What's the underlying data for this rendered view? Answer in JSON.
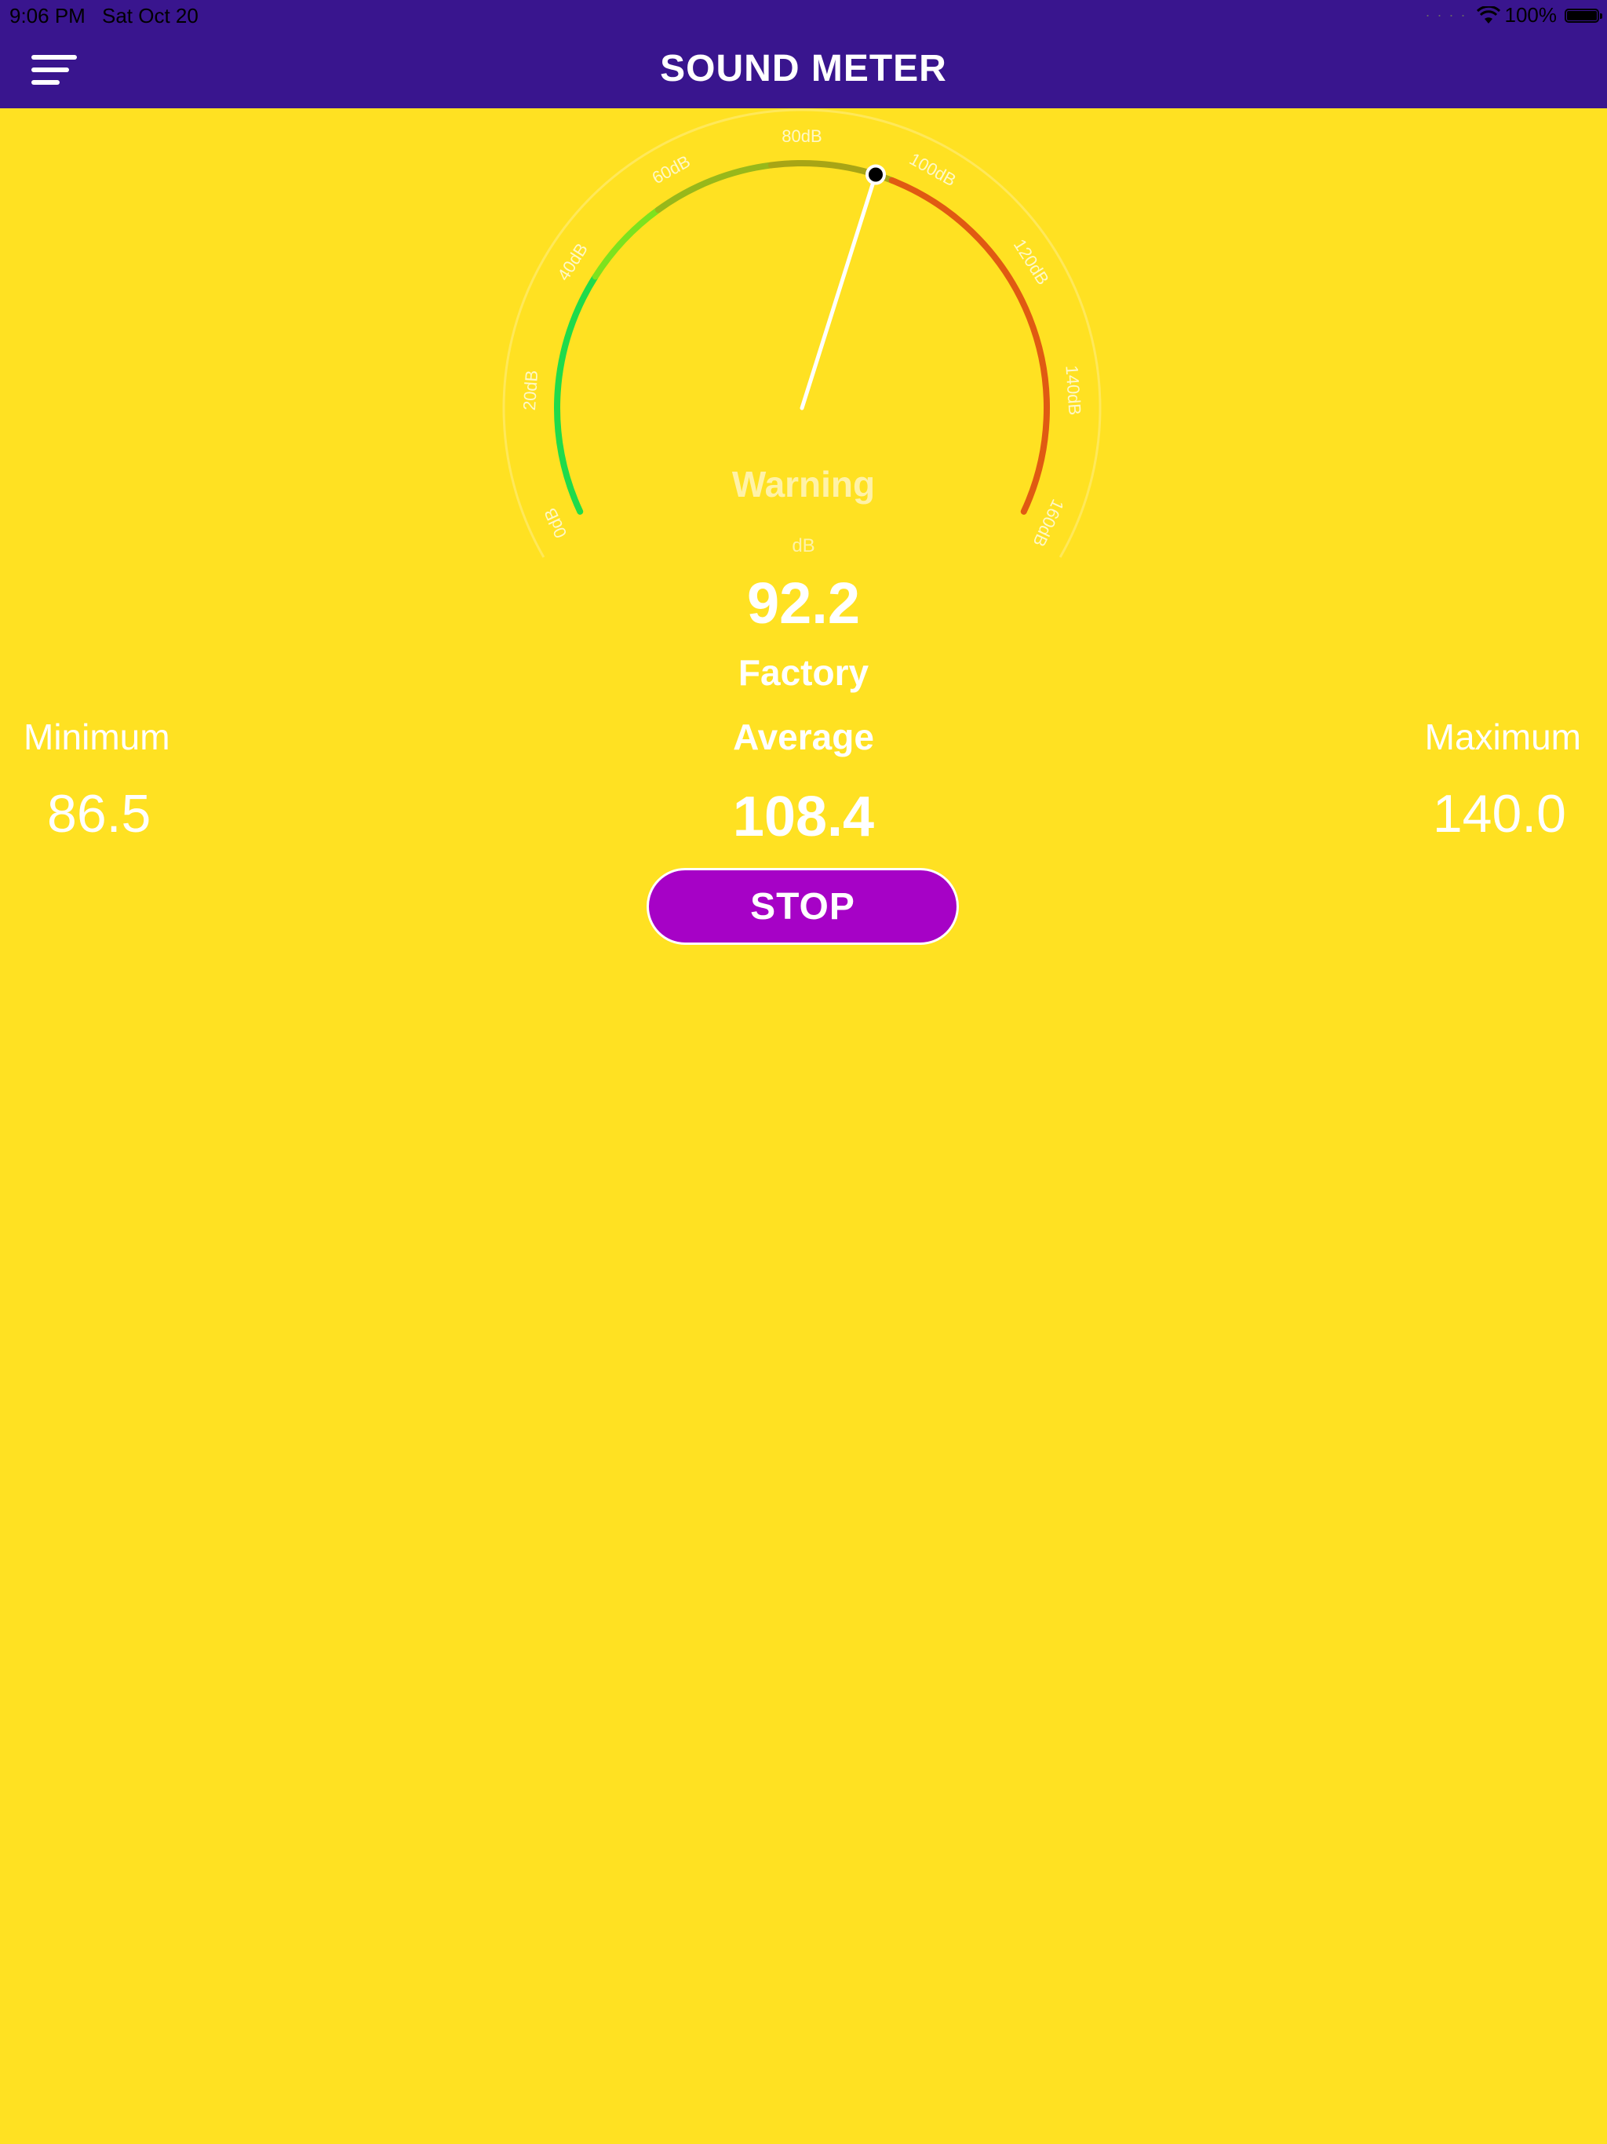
{
  "status_bar": {
    "time": "9:06 PM",
    "date": "Sat Oct 20",
    "battery": "100%"
  },
  "nav": {
    "title": "SOUND METER",
    "menu_icon": "hamburger-menu-icon"
  },
  "gauge": {
    "ticks": [
      "0dB",
      "20dB",
      "40dB",
      "60dB",
      "80dB",
      "100dB",
      "120dB",
      "140dB",
      "160dB"
    ],
    "min_db": 0,
    "max_db": 160,
    "needle_db": 92.2,
    "colors": {
      "low": "#1FDB4B",
      "mid": "#A8A515",
      "high": "#E05A12"
    }
  },
  "reading": {
    "status": "Warning",
    "unit": "dB",
    "current": "92.2",
    "environment": "Factory",
    "average_label": "Average",
    "average": "108.4"
  },
  "minimum": {
    "label": "Minimum",
    "value": "86.5"
  },
  "maximum": {
    "label": "Maximum",
    "value": "140.0"
  },
  "controls": {
    "stop_label": "STOP"
  },
  "theme": {
    "background": "#FFE122",
    "nav_background": "#39158E",
    "button": "#A602C6"
  }
}
